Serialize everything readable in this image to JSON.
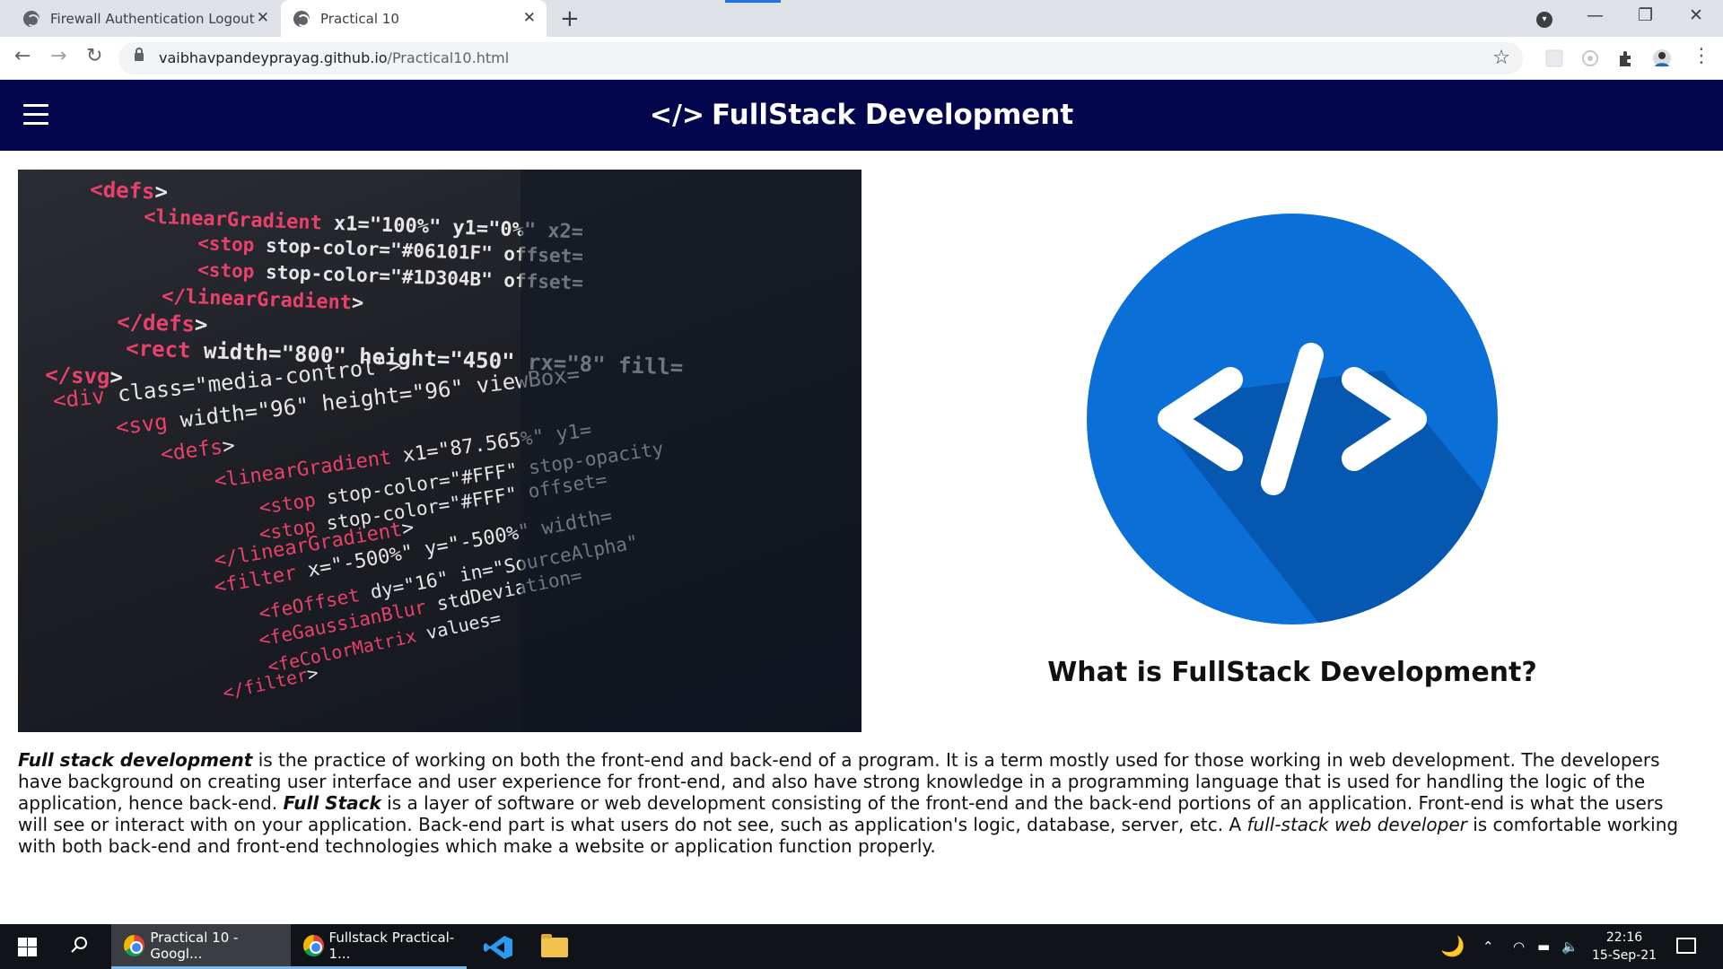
{
  "browser": {
    "tabs": [
      {
        "title": "Firewall Authentication Logout"
      },
      {
        "title": "Practical 10",
        "active": true
      }
    ],
    "url_host": "vaibhavpandeyprayag.github.io",
    "url_path": "/Practical10.html"
  },
  "header": {
    "icon_text": "</>",
    "title": "FullStack Development"
  },
  "code_image": {
    "lines": [
      "<defs>",
      "<linearGradient x1=\"100%\" y1=\"0%\" x2=",
      "<stop stop-color=\"#06101F\" offset=",
      "<stop stop-color=\"#1D304B\" offset=",
      "</linearGradient>",
      "</defs>",
      "<rect width=\"800\" height=\"450\" rx=\"8\" fill=",
      "</svg>",
      "<div class=\"media-control\">",
      "<svg width=\"96\" height=\"96\" viewBox=",
      "<defs>",
      "<linearGradient x1=\"87.565%\" y1=",
      "<stop stop-color=\"#FFF\" stop-opacity",
      "<stop stop-color=\"#FFF\" offset=",
      "</linearGradient>",
      "<filter x=\"-500%\" y=\"-500%\" width=",
      "<feOffset dy=\"16\" in=\"SourceAlpha\"",
      "<feGaussianBlur stdDeviation=",
      "<feColorMatrix values=",
      "</filter>"
    ]
  },
  "logo": {
    "glyph": "</>"
  },
  "section": {
    "heading": "What is FullStack Development?"
  },
  "description": {
    "term1": "Full stack development",
    "text1": " is the practice of working on both the front-end and back-end of a program. It is a term mostly used for those working in web development. The developers have background on creating user interface and user experience for front-end, and also have strong knowledge in a programming language that is used for handling the logic of the application, hence back-end. ",
    "term2": "Full Stack",
    "text2": " is a layer of software or web development consisting of the front-end and the back-end portions of an application. Front-end is what the users will see or interact with on your application. Back-end part is what users do not see, such as application's logic, database, server, etc. A ",
    "term3": "full-stack web developer",
    "text3": " is comfortable working with both back-end and front-end technologies which make a website or application function properly."
  },
  "taskbar": {
    "apps": [
      {
        "label": "Practical 10 - Googl..."
      },
      {
        "label": "Fullstack Practical-1..."
      }
    ],
    "time": "22:16",
    "date": "15-Sep-21"
  },
  "colors": {
    "header_bg": "#03054d",
    "logo_blue": "#0a6fd6",
    "logo_shadow": "#0557b0",
    "tag_pink": "#e8416b",
    "attr_white": "#e6e6e6"
  }
}
